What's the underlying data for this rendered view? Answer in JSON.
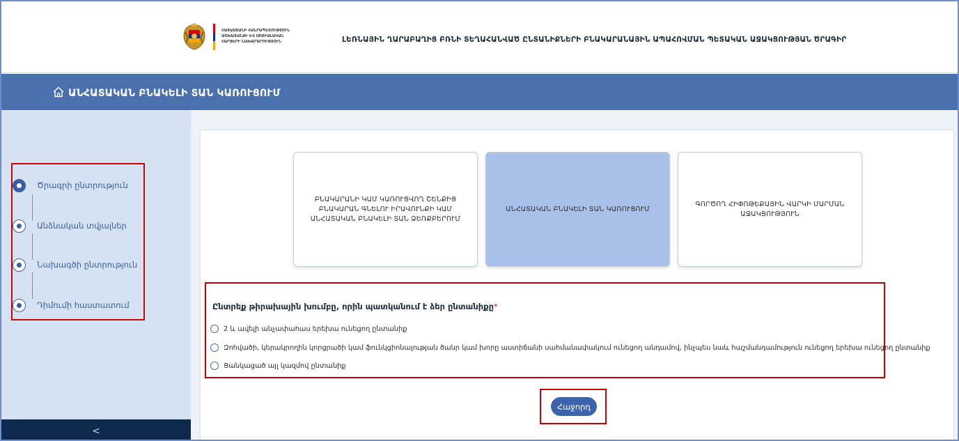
{
  "header": {
    "ministry_lines": [
      "ՀԱՅԱՍՏԱՆԻ ՀԱՆՐԱՊԵՏՈՒԹՅՈՒՆ",
      "ԱՇԽԱՏԱՆՔԻ ԵՎ ՍՈՑԻԱԼԱԿԱՆ",
      "ՀԱՐՑԵՐԻ ՆԱԽԱՐԱՐՈՒԹՅՈՒՆ"
    ],
    "program_title": "ԼԵՌՆԱՅԻՆ ՂԱՐԱԲԱՂԻՑ ԲՌՆԻ ՏԵՂԱՀԱՆՎԱԾ ԸՆՏԱՆԻՔՆԵՐԻ ԲՆԱԿԱՐԱՆԱՅԻՆ ԱՊԱՀՈՎՄԱՆ ՊԵՏԱԿԱՆ ԱՋԱԿՑՈՒԹՅԱՆ ԾՐԱԳԻՐ",
    "flag_colors": [
      "#d90012",
      "#0033a0",
      "#f2a800"
    ]
  },
  "band": {
    "home_icon": "home-icon",
    "title": "ԱՆՀԱՏԱԿԱՆ ԲՆԱԿԵԼԻ ՏԱՆ ԿԱՌՈՒՑՈՒՄ"
  },
  "sidebar": {
    "steps": [
      {
        "label": "Ծրագրի ընտրություն",
        "active": true
      },
      {
        "label": "Անձնական տվյալներ",
        "active": false
      },
      {
        "label": "Նախագծի ընտրություն",
        "active": false
      },
      {
        "label": "Դիմումի հաստատում",
        "active": false
      }
    ],
    "collapse_label": "<"
  },
  "programs": [
    {
      "label": "ԲՆԱԿԱՐԱՆԻ ԿԱՄ ԿԱՌՈՒՑՎՈՂ ՇԵՆՔԻՑ ԲՆԱԿԱՐԱՆ ԳՆԵԼՈՒ ԻՐԱՎՈՒՆՔԻ ԿԱՄ ԱՆՀԱՏԱԿԱՆ ԲՆԱԿԵԼԻ ՏԱՆ ՁԵՌՔԲԵՐՈՒՄ",
      "selected": false
    },
    {
      "label": "ԱՆՀԱՏԱԿԱՆ ԲՆԱԿԵԼԻ ՏԱՆ ԿԱՌՈՒՑՈՒՄ",
      "selected": true
    },
    {
      "label": "ԳՈՐԾՈՂ ՀԻՓՈԹԵՔԱՅԻՆ ՎԱՐԿԻ ՄԱՐՄԱՆ ԱՋԱԿՑՈՒԹՅՈՒՆ",
      "selected": false
    }
  ],
  "form": {
    "question": "Ընտրեք թիրախային խումբը, որին պատկանում է ձեր ընտանիքը",
    "required_mark": "*",
    "options": [
      "2 և ավելի անչափահաս երեխա ունեցող ընտանիք",
      "Զոհվածի, կերակրողին կորցրածի կամ ֆունկցիոնալության ծանր կամ խորը աստիճանի սահմանափակում ունեցող անդամով, ինչպես նաև հաշմանդամություն ունեցող երեխա ունեցող ընտանիք",
      "Ցանկացած այլ կազմով ընտանիք"
    ]
  },
  "next_button": "Հաջորդ",
  "colors": {
    "band": "#4a71ae",
    "sidebar": "#d4e2f4",
    "accent": "#3a5e9f",
    "selected_card": "#a9c1ea",
    "highlight": "#cc0000"
  }
}
